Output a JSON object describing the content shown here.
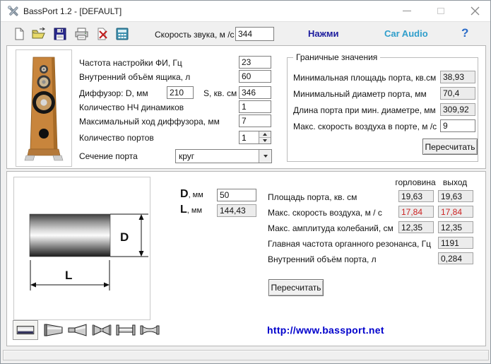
{
  "window": {
    "title": "BassPort 1.2 - [DEFAULT]"
  },
  "toolbar": {
    "icons": [
      "new-file",
      "open-file",
      "save-file",
      "print",
      "delete",
      "calculator"
    ],
    "speed_label": "Скорость звука, м /с",
    "speed_value": "344",
    "press_link": "Нажми",
    "car_audio_link": "Car Audio",
    "help_label": "?"
  },
  "params": {
    "rows": [
      {
        "label": "Частота настройки ФИ, Гц",
        "value": "23"
      },
      {
        "label": "Внутренний объём ящика, л",
        "value": "60"
      },
      {
        "label": "Диффузор: D, мм",
        "value": "210",
        "label2": "S, кв. см",
        "value2": "346"
      },
      {
        "label": "Количество НЧ динамиков",
        "value": "1"
      },
      {
        "label": "Максимальный ход диффузора, мм",
        "value": "7"
      },
      {
        "label": "Количество портов",
        "value": "1"
      },
      {
        "label": "Сечение порта",
        "value": "круг"
      }
    ]
  },
  "limits": {
    "title": "Граничные значения",
    "rows": [
      {
        "label": "Минимальная площадь порта, кв.см",
        "value": "38,93"
      },
      {
        "label": "Минимальный диаметр порта, мм",
        "value": "70,4"
      },
      {
        "label": "Длина порта при мин. диаметре, мм",
        "value": "309,92"
      },
      {
        "label": "Макс. скорость воздуха в порте, м /с",
        "value": "9"
      }
    ],
    "recalc_label": "Пересчитать"
  },
  "port": {
    "d_label": "D",
    "d_unit": ", мм",
    "d_value": "50",
    "l_label": "L",
    "l_unit": ", мм",
    "l_value": "144,43",
    "diagram_d": "D",
    "diagram_l": "L",
    "col_throat": "горловина",
    "col_exit": "выход",
    "results": [
      {
        "label": "Площадь порта, кв. см",
        "throat": "19,63",
        "exit": "19,63"
      },
      {
        "label": "Макс. скорость воздуха, м / с",
        "throat": "17,84",
        "exit": "17,84"
      },
      {
        "label": "Макс. амплитуда колебаний, см",
        "throat": "12,35",
        "exit": "12,35"
      },
      {
        "label": "Главная частота органного резонанса, Гц",
        "exit": "1191"
      },
      {
        "label": "Внутренний объём порта, л",
        "exit": "0,284"
      }
    ],
    "recalc_label": "Пересчитать",
    "url": "http://www.bassport.net",
    "shapes": [
      "cylinder",
      "cone",
      "horn",
      "double-cone",
      "flanged-tube",
      "double-flared-tube"
    ]
  },
  "colors": {
    "press_navy": "#1d1d9e",
    "car_audio_blue": "#2f9ecb",
    "help_blue": "#2a6bc8",
    "url_blue": "#0000cc",
    "warning_red": "#cc2222"
  }
}
